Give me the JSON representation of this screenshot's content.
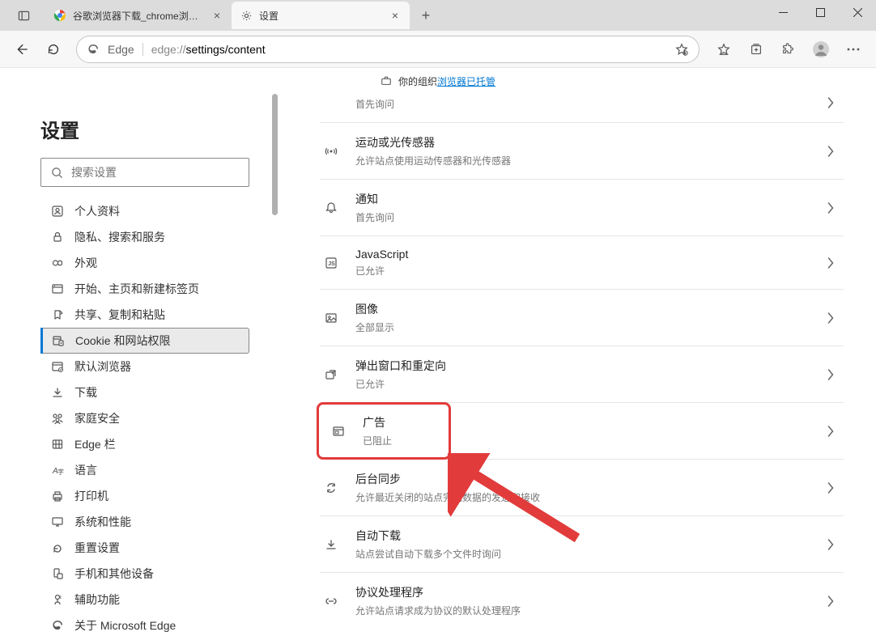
{
  "window": {
    "tabs": [
      {
        "label": "谷歌浏览器下载_chrome浏览器",
        "active": false
      },
      {
        "label": "设置",
        "active": true
      }
    ]
  },
  "addressbar": {
    "app": "Edge",
    "url_prefix": "edge://",
    "url_path": "settings/content"
  },
  "banner": {
    "text": "你的组织",
    "link": "浏览器已托管"
  },
  "sidebar": {
    "title": "设置",
    "search_placeholder": "搜索设置",
    "items": [
      {
        "label": "个人资料"
      },
      {
        "label": "隐私、搜索和服务"
      },
      {
        "label": "外观"
      },
      {
        "label": "开始、主页和新建标签页"
      },
      {
        "label": "共享、复制和粘贴"
      },
      {
        "label": "Cookie 和网站权限",
        "selected": true
      },
      {
        "label": "默认浏览器"
      },
      {
        "label": "下载"
      },
      {
        "label": "家庭安全"
      },
      {
        "label": "Edge 栏"
      },
      {
        "label": "语言"
      },
      {
        "label": "打印机"
      },
      {
        "label": "系统和性能"
      },
      {
        "label": "重置设置"
      },
      {
        "label": "手机和其他设备"
      },
      {
        "label": "辅助功能"
      },
      {
        "label": "关于 Microsoft Edge"
      }
    ]
  },
  "settings_rows": [
    {
      "title": "",
      "sub": "首先询问",
      "icon": ""
    },
    {
      "title": "运动或光传感器",
      "sub": "允许站点使用运动传感器和光传感器",
      "icon": "sensor"
    },
    {
      "title": "通知",
      "sub": "首先询问",
      "icon": "bell"
    },
    {
      "title": "JavaScript",
      "sub": "已允许",
      "icon": "js"
    },
    {
      "title": "图像",
      "sub": "全部显示",
      "icon": "image"
    },
    {
      "title": "弹出窗口和重定向",
      "sub": "已允许",
      "icon": "popup"
    },
    {
      "title": "广告",
      "sub": "已阻止",
      "icon": "ads",
      "highlighted": true
    },
    {
      "title": "后台同步",
      "sub": "允许最近关闭的站点完成数据的发送和接收",
      "icon": "sync"
    },
    {
      "title": "自动下载",
      "sub": "站点尝试自动下载多个文件时询问",
      "icon": "download"
    },
    {
      "title": "协议处理程序",
      "sub": "允许站点请求成为协议的默认处理程序",
      "icon": "protocol"
    }
  ]
}
